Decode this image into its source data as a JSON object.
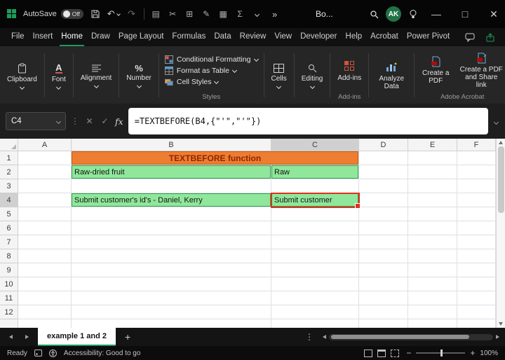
{
  "titlebar": {
    "autosave_label": "AutoSave",
    "autosave_state": "Off",
    "doc_name": "Bo...",
    "avatar_initials": "AK"
  },
  "menubar": {
    "items": [
      "File",
      "Insert",
      "Home",
      "Draw",
      "Page Layout",
      "Formulas",
      "Data",
      "Review",
      "View",
      "Developer",
      "Help",
      "Acrobat",
      "Power Pivot"
    ],
    "active_item": "Home"
  },
  "ribbon": {
    "clipboard_label": "Clipboard",
    "font_label": "Font",
    "alignment_label": "Alignment",
    "number_label": "Number",
    "conditional_formatting_label": "Conditional Formatting",
    "format_as_table_label": "Format as Table",
    "cell_styles_label": "Cell Styles",
    "styles_group_label": "Styles",
    "cells_label": "Cells",
    "editing_label": "Editing",
    "addins_button_label": "Add-ins",
    "addins_group_label": "Add-ins",
    "analyze_data_label": "Analyze Data",
    "create_pdf_label": "Create a PDF",
    "create_pdf_share_label": "Create a PDF and Share link",
    "acrobat_group_label": "Adobe Acrobat"
  },
  "formula_bar": {
    "name_box_value": "C4",
    "fx_label": "fx",
    "formula": "=TEXTBEFORE(B4,{\"'\",\"'\"})"
  },
  "grid": {
    "column_headers": [
      "A",
      "B",
      "C",
      "D",
      "E",
      "F"
    ],
    "row_count": 12,
    "selected_column": "C",
    "selected_row": 4,
    "title_cell": {
      "ref": "B1:C1",
      "text": "TEXTBEFORE function"
    },
    "cells": [
      {
        "ref": "B2",
        "col": "B",
        "row": 2,
        "text": "Raw-dried fruit",
        "style": "green"
      },
      {
        "ref": "C2",
        "col": "C",
        "row": 2,
        "text": "Raw",
        "style": "green"
      },
      {
        "ref": "B4",
        "col": "B",
        "row": 4,
        "text": "Submit customer's id's - Daniel, Kerry",
        "style": "green"
      },
      {
        "ref": "C4",
        "col": "C",
        "row": 4,
        "text": "Submit customer",
        "style": "green selred"
      }
    ]
  },
  "sheet_tabs": {
    "active_tab": "example 1 and 2",
    "add_label": "+"
  },
  "statusbar": {
    "mode": "Ready",
    "accessibility": "Accessibility: Good to go",
    "zoom_level": "100%"
  },
  "colors": {
    "orange_fill": "#ED7D31",
    "orange_border": "#C55A11",
    "orange_text": "#8F2500",
    "green_fill": "#90E79B",
    "green_border": "#2E9E4E",
    "selection_red": "#E0301E",
    "accent_green": "#1E9C5A",
    "avatar_green": "#217346"
  }
}
